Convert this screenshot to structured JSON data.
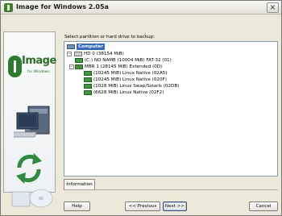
{
  "window": {
    "title": "Image for Windows  2.05a",
    "close_symbol": "×"
  },
  "sidebar": {
    "logo_text": "Image",
    "logo_subtitle": "for Windows",
    "icons": [
      "image-logo-icon",
      "monitor-icon",
      "refresh-arrows-icon",
      "disc-icon"
    ]
  },
  "main": {
    "prompt": "Select partition or hard drive to backup:",
    "tree": {
      "computer": "Computer",
      "hd": "HD 0 (38154 MiB)",
      "partitions": [
        "(C:) NO NAME (10004 MiB) FAT-32 (01)",
        "MBR 1 (28145 MiB) Extended (0D)",
        "(10245 MiB) Linux Native (02A5)",
        "(10245 MiB) Linux Native (020F)",
        "(1028 MiB) Linux Swap/Solaris (02DB)",
        "(6628 MiB) Linux Native (02F2)"
      ]
    },
    "info_tab": "Information"
  },
  "buttons": {
    "help": "Help",
    "previous": "<< Previous",
    "next": "Next >>",
    "cancel": "Cancel"
  },
  "colors": {
    "selection": "#316ac5",
    "brand_green": "#2b6e25",
    "tree_border": "#7f9db9"
  }
}
